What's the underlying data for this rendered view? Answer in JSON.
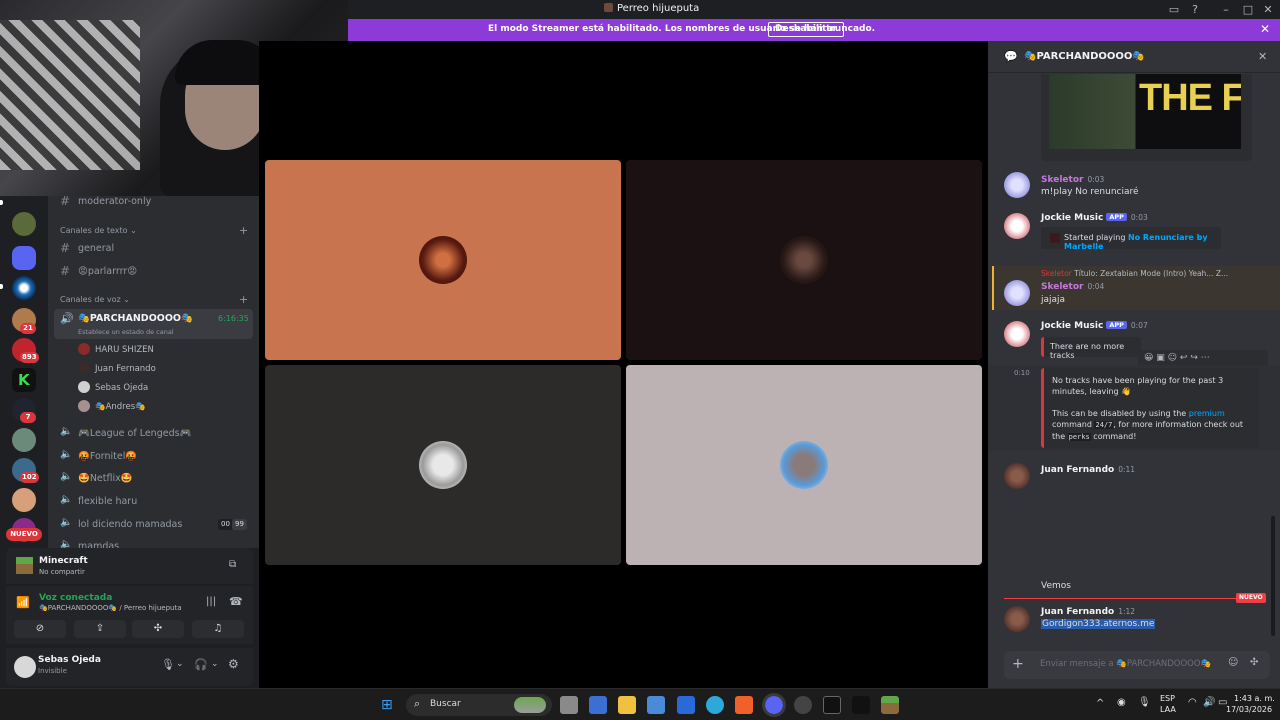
{
  "window": {
    "title": "Perreo hijueputa"
  },
  "banner": {
    "message": "El modo Streamer está habilitado. Los nombres de usuario se han truncado.",
    "button": "Deshabilitar",
    "color": "#8d3bd8"
  },
  "rail": {
    "badges": [
      "21",
      "893",
      "7",
      "102"
    ],
    "new_label": "NUEVO"
  },
  "channels": {
    "moderator": "moderator-only",
    "text_category": "Canales de texto",
    "general": "general",
    "parlar": "😡parlarrrr😡",
    "voice_category": "Canales de voz",
    "active_voice": "🎭PARCHANDOOOO🎭",
    "active_timer": "6:16:35",
    "active_status": "Establece un estado de canal",
    "members": [
      "HARU SHIZEN",
      "Juan Fernando",
      "Sebas Ojeda",
      "🎭Andres🎭"
    ],
    "league": "🎮League of Lengeds🎮",
    "fornite": "🤬Fornitel🤬",
    "netflix": "🤩Netflix🤩",
    "haru": "flexible haru",
    "lol": "lol diciendo mamadas",
    "lol_count_a": "00",
    "lol_count_b": "99",
    "cut": "mamdas"
  },
  "activity": {
    "game": "Minecraft",
    "status": "No compartir"
  },
  "voice": {
    "title": "Voz conectada",
    "location": "🎭PARCHANDOOOO🎭 / Perreo hijueputa"
  },
  "user": {
    "name": "Sebas Ojeda",
    "status": "Invisible"
  },
  "chat": {
    "channel": "🎭PARCHANDOOOO🎭",
    "image_caption": "THE FOREST",
    "messages": [
      {
        "author": "Skeletor",
        "time": "0:03",
        "text": "m!play No renunciaré"
      },
      {
        "author": "Jockie Music",
        "app": "APP",
        "time": "0:03",
        "embed_prefix": "Started playing ",
        "embed_link": "No Renunciare by Marbelle"
      },
      {
        "reply": "Título: Zextabian Mode (Intro) Yeah... Z...",
        "author": "Skeletor",
        "time": "0:04",
        "text": "jajaja"
      },
      {
        "author": "Jockie Music",
        "app": "APP",
        "time": "0:07",
        "embed": "There are no more tracks"
      },
      {
        "time": "0:10",
        "line1": "No tracks have been playing for the past 3 minutes, leaving 👋",
        "line2a": "This can be disabled by using the ",
        "premium": "premium",
        "line2b": " command ",
        "code1": "24/7",
        "line2c": ", for more information check out the ",
        "code2": "perks",
        "line2d": " command!"
      },
      {
        "author": "Juan Fernando",
        "time": "0:11"
      }
    ],
    "vemos": "Vemos",
    "new_divider": "NUEVO",
    "last_author": "Juan Fernando",
    "last_time": "1:12",
    "last_text": "Gordigon333.aternos.me",
    "input_placeholder": "Enviar mensaje a 🎭PARCHANDOOOO🎭"
  },
  "taskbar": {
    "search": "Buscar",
    "lang": "ESP",
    "region": "LAA",
    "time": "1:43 a. m.",
    "date": "17/03/2026"
  },
  "colors": {
    "orange_tile": "#c8754f",
    "dark_tile": "#1b1112",
    "grey_tile": "#2d2b29",
    "light_tile": "#bdb2b3",
    "accent": "#5865f2"
  }
}
